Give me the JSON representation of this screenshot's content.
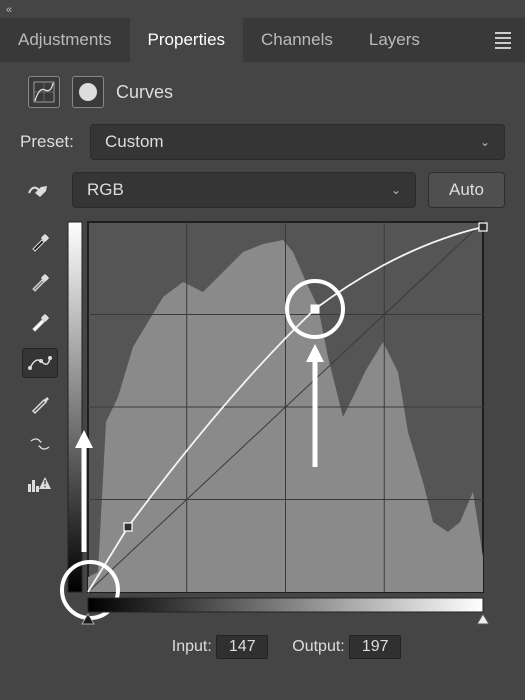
{
  "chevrons": "«",
  "tabs": {
    "adjustments": "Adjustments",
    "properties": "Properties",
    "channels": "Channels",
    "layers": "Layers"
  },
  "subhead": {
    "title": "Curves"
  },
  "preset": {
    "label": "Preset:",
    "value": "Custom"
  },
  "channel": {
    "value": "RGB"
  },
  "auto_label": "Auto",
  "tools": {
    "finger": "on-image-adjust",
    "eyedrop_black": "black-point",
    "eyedrop_gray": "gray-point",
    "eyedrop_white": "white-point",
    "curve": "smooth-curve",
    "pencil": "draw-curve",
    "smooth": "smooth-values",
    "clip": "clip-warning"
  },
  "readout": {
    "input_label": "Input:",
    "input_value": "147",
    "output_label": "Output:",
    "output_value": "197"
  }
}
